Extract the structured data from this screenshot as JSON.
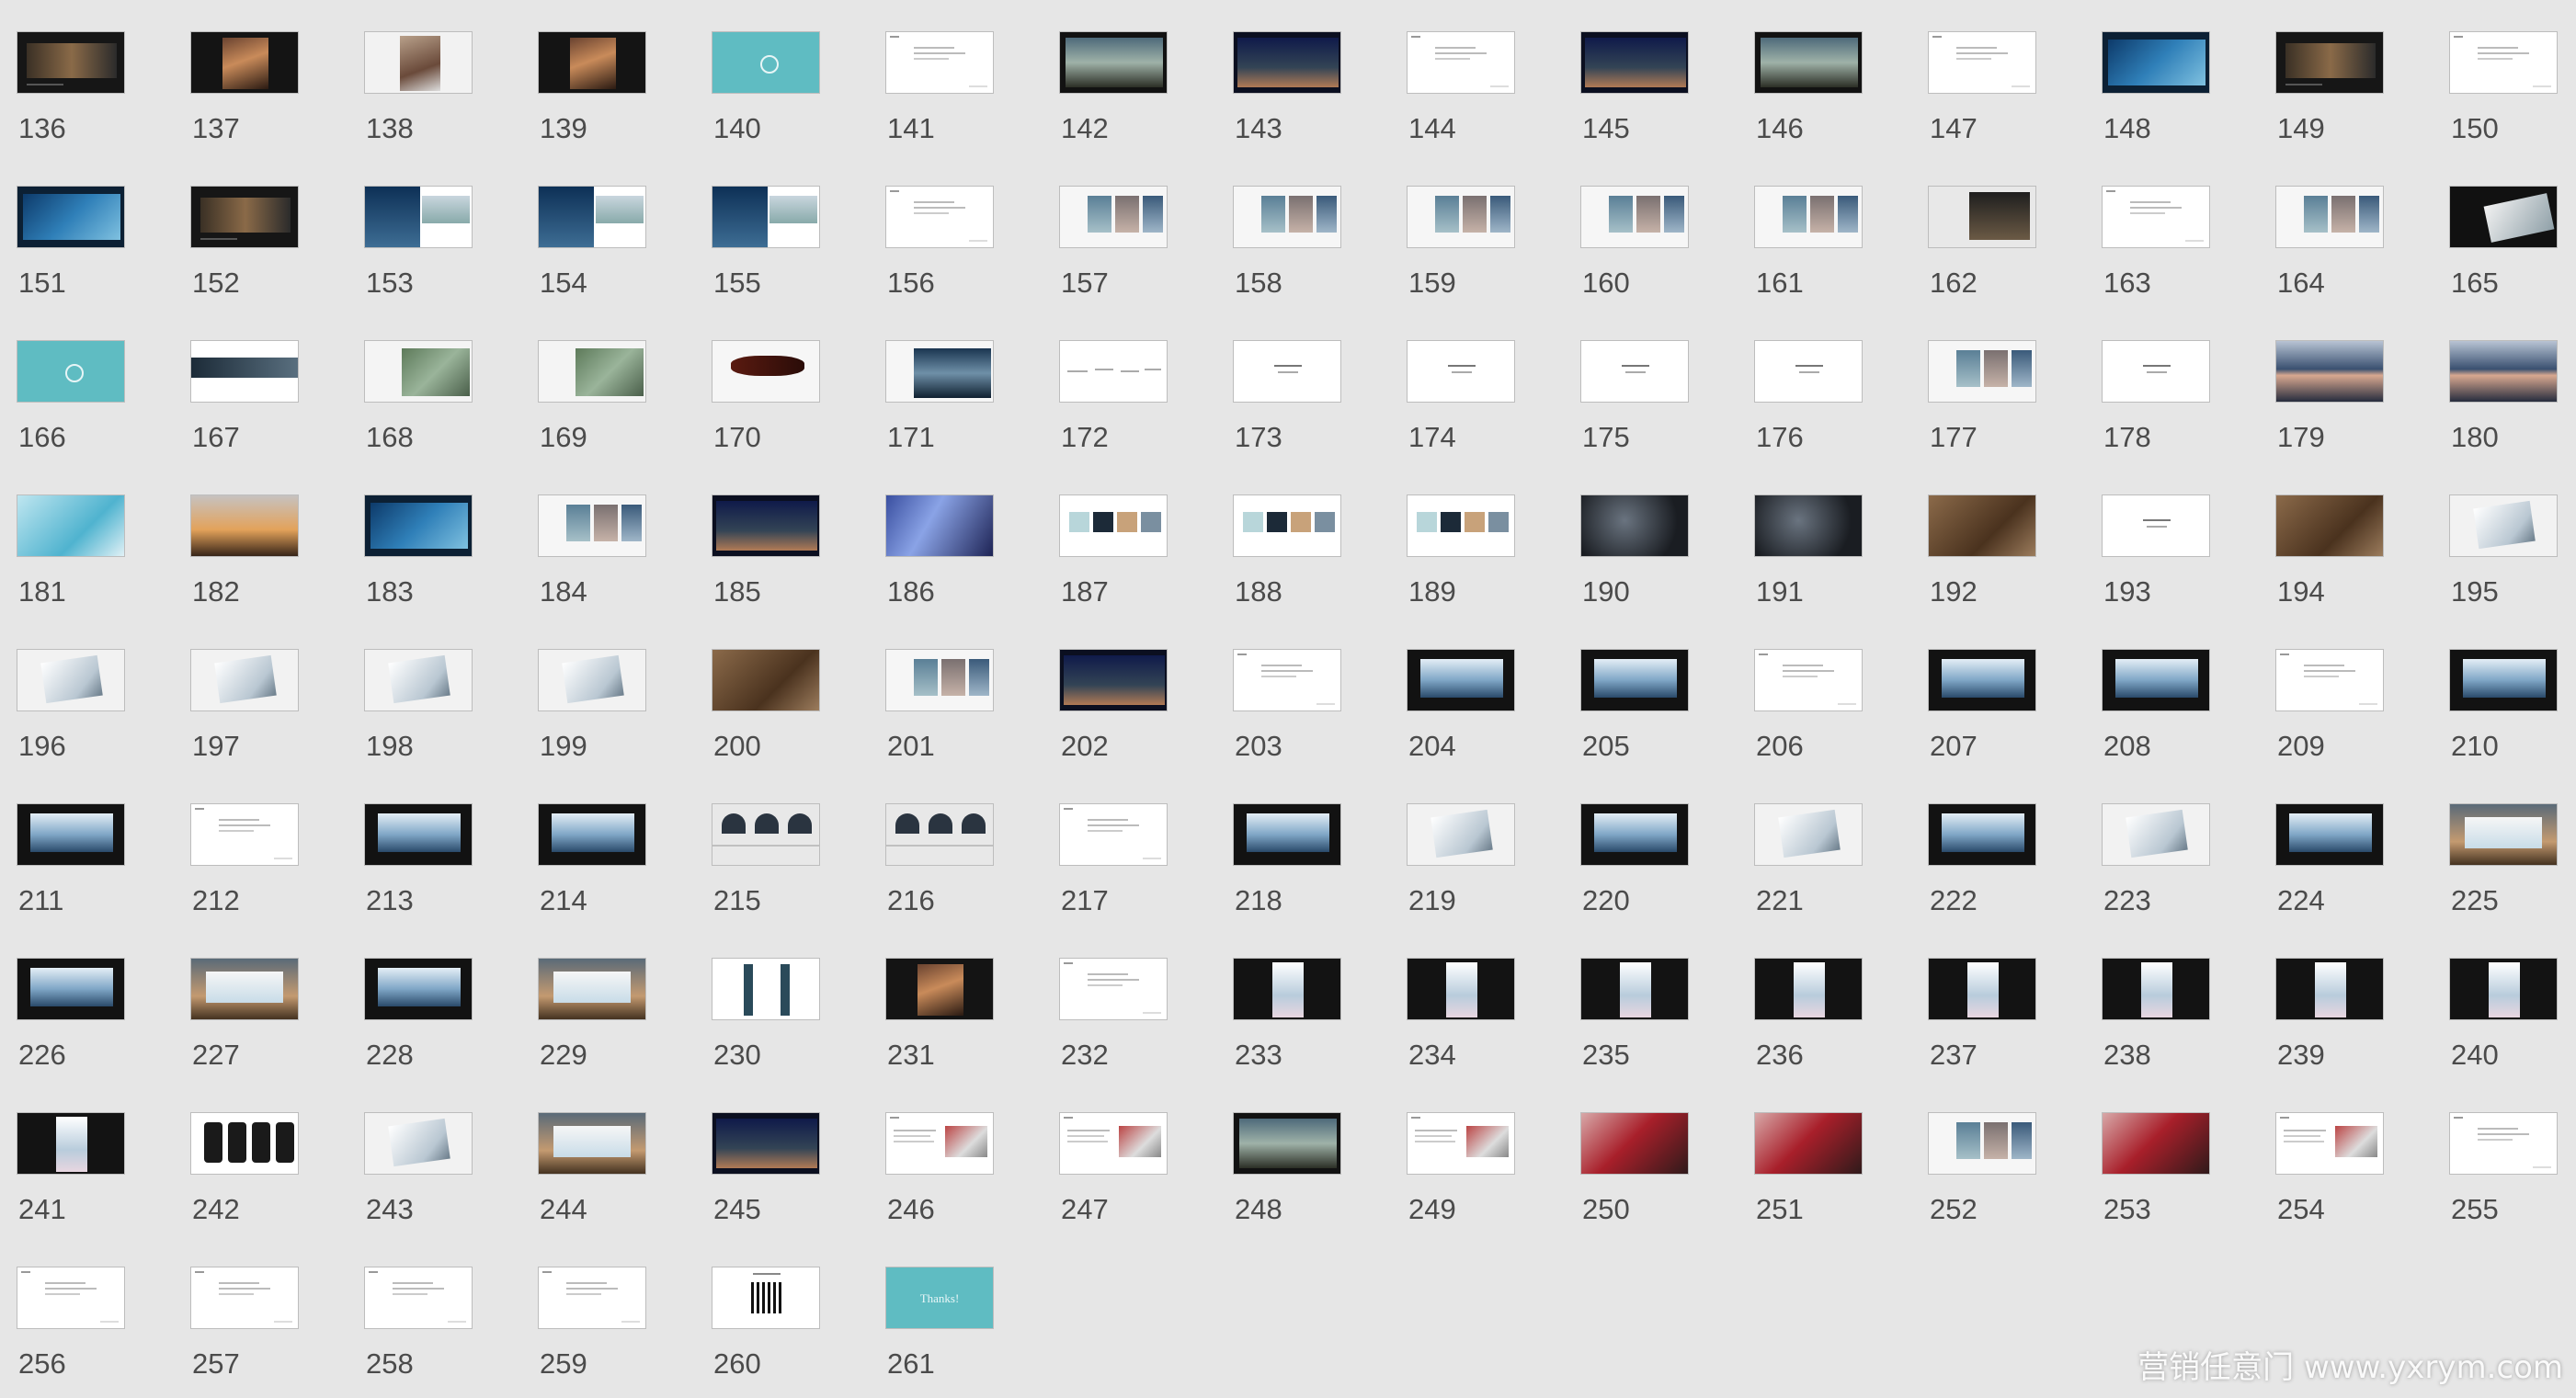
{
  "palette": {
    "background": "#e6e6e6",
    "teal": "#5fbcc2",
    "dark": "#141414",
    "navy": "#0c2034",
    "white": "#ffffff",
    "number_text": "#4b4b4b"
  },
  "slides": [
    {
      "num": "136",
      "style": "dark-gallery"
    },
    {
      "num": "137",
      "style": "dark-portrait"
    },
    {
      "num": "138",
      "style": "light-portrait"
    },
    {
      "num": "139",
      "style": "dark-portrait"
    },
    {
      "num": "140",
      "style": "teal-logo"
    },
    {
      "num": "141",
      "style": "text-white"
    },
    {
      "num": "142",
      "style": "dark-photo"
    },
    {
      "num": "143",
      "style": "night-photo"
    },
    {
      "num": "144",
      "style": "text-white"
    },
    {
      "num": "145",
      "style": "night-photo"
    },
    {
      "num": "146",
      "style": "dark-photo"
    },
    {
      "num": "147",
      "style": "text-white"
    },
    {
      "num": "148",
      "style": "blue-photo"
    },
    {
      "num": "149",
      "style": "dark-gallery"
    },
    {
      "num": "150",
      "style": "text-white"
    },
    {
      "num": "151",
      "style": "blue-photo"
    },
    {
      "num": "152",
      "style": "dark-gallery"
    },
    {
      "num": "153",
      "style": "split-photo"
    },
    {
      "num": "154",
      "style": "split-photo"
    },
    {
      "num": "155",
      "style": "split-photo"
    },
    {
      "num": "156",
      "style": "text-white"
    },
    {
      "num": "157",
      "style": "light-photos"
    },
    {
      "num": "158",
      "style": "light-photos"
    },
    {
      "num": "159",
      "style": "light-photos"
    },
    {
      "num": "160",
      "style": "light-photos"
    },
    {
      "num": "161",
      "style": "light-photos"
    },
    {
      "num": "162",
      "style": "light-dark"
    },
    {
      "num": "163",
      "style": "text-white"
    },
    {
      "num": "164",
      "style": "light-photos"
    },
    {
      "num": "165",
      "style": "dark-card"
    },
    {
      "num": "166",
      "style": "teal-logo"
    },
    {
      "num": "167",
      "style": "light-band"
    },
    {
      "num": "168",
      "style": "light-map"
    },
    {
      "num": "169",
      "style": "light-map"
    },
    {
      "num": "170",
      "style": "light-ink"
    },
    {
      "num": "171",
      "style": "light-sea"
    },
    {
      "num": "172",
      "style": "sketch-white"
    },
    {
      "num": "173",
      "style": "logo-white"
    },
    {
      "num": "174",
      "style": "logo-white"
    },
    {
      "num": "175",
      "style": "logo-white"
    },
    {
      "num": "176",
      "style": "logo-white"
    },
    {
      "num": "177",
      "style": "light-photos"
    },
    {
      "num": "178",
      "style": "logo-white"
    },
    {
      "num": "179",
      "style": "blur-sea"
    },
    {
      "num": "180",
      "style": "blur-sea"
    },
    {
      "num": "181",
      "style": "aqua-photo"
    },
    {
      "num": "182",
      "style": "sunset-photo"
    },
    {
      "num": "183",
      "style": "blue-photo"
    },
    {
      "num": "184",
      "style": "light-photos"
    },
    {
      "num": "185",
      "style": "night-photo"
    },
    {
      "num": "186",
      "style": "pool-photo"
    },
    {
      "num": "187",
      "style": "swatch"
    },
    {
      "num": "188",
      "style": "swatch"
    },
    {
      "num": "189",
      "style": "swatch"
    },
    {
      "num": "190",
      "style": "dark-texture"
    },
    {
      "num": "191",
      "style": "dark-texture"
    },
    {
      "num": "192",
      "style": "brown-texture"
    },
    {
      "num": "193",
      "style": "logo-white"
    },
    {
      "num": "194",
      "style": "brown-texture"
    },
    {
      "num": "195",
      "style": "light-card"
    },
    {
      "num": "196",
      "style": "light-card"
    },
    {
      "num": "197",
      "style": "light-card"
    },
    {
      "num": "198",
      "style": "light-card"
    },
    {
      "num": "199",
      "style": "light-card"
    },
    {
      "num": "200",
      "style": "brown-texture"
    },
    {
      "num": "201",
      "style": "light-photos"
    },
    {
      "num": "202",
      "style": "night-photo"
    },
    {
      "num": "203",
      "style": "text-white"
    },
    {
      "num": "204",
      "style": "dark-billboard"
    },
    {
      "num": "205",
      "style": "dark-billboard"
    },
    {
      "num": "206",
      "style": "text-white"
    },
    {
      "num": "207",
      "style": "dark-billboard"
    },
    {
      "num": "208",
      "style": "dark-billboard"
    },
    {
      "num": "209",
      "style": "text-white"
    },
    {
      "num": "210",
      "style": "dark-billboard"
    },
    {
      "num": "211",
      "style": "dark-billboard"
    },
    {
      "num": "212",
      "style": "text-white"
    },
    {
      "num": "213",
      "style": "dark-billboard"
    },
    {
      "num": "214",
      "style": "dark-billboard"
    },
    {
      "num": "215",
      "style": "light-arch"
    },
    {
      "num": "216",
      "style": "light-arch"
    },
    {
      "num": "217",
      "style": "text-white"
    },
    {
      "num": "218",
      "style": "dark-billboard"
    },
    {
      "num": "219",
      "style": "light-card"
    },
    {
      "num": "220",
      "style": "dark-billboard"
    },
    {
      "num": "221",
      "style": "light-card"
    },
    {
      "num": "222",
      "style": "dark-billboard"
    },
    {
      "num": "223",
      "style": "light-card"
    },
    {
      "num": "224",
      "style": "dark-billboard"
    },
    {
      "num": "225",
      "style": "sky-billboard"
    },
    {
      "num": "226",
      "style": "dark-billboard"
    },
    {
      "num": "227",
      "style": "sky-billboard"
    },
    {
      "num": "228",
      "style": "dark-billboard"
    },
    {
      "num": "229",
      "style": "sky-billboard"
    },
    {
      "num": "230",
      "style": "light-poles"
    },
    {
      "num": "231",
      "style": "dark-portrait"
    },
    {
      "num": "232",
      "style": "text-white"
    },
    {
      "num": "233",
      "style": "dark-panel"
    },
    {
      "num": "234",
      "style": "dark-panel"
    },
    {
      "num": "235",
      "style": "dark-panel"
    },
    {
      "num": "236",
      "style": "dark-panel"
    },
    {
      "num": "237",
      "style": "dark-panel"
    },
    {
      "num": "238",
      "style": "dark-panel"
    },
    {
      "num": "239",
      "style": "dark-panel"
    },
    {
      "num": "240",
      "style": "dark-panel"
    },
    {
      "num": "241",
      "style": "dark-panel"
    },
    {
      "num": "242",
      "style": "phones"
    },
    {
      "num": "243",
      "style": "light-card"
    },
    {
      "num": "244",
      "style": "sky-billboard"
    },
    {
      "num": "245",
      "style": "night-photo"
    },
    {
      "num": "246",
      "style": "text-photo"
    },
    {
      "num": "247",
      "style": "text-photo"
    },
    {
      "num": "248",
      "style": "dark-photo"
    },
    {
      "num": "249",
      "style": "text-photo"
    },
    {
      "num": "250",
      "style": "red-photo"
    },
    {
      "num": "251",
      "style": "red-photo"
    },
    {
      "num": "252",
      "style": "light-photos"
    },
    {
      "num": "253",
      "style": "red-photo"
    },
    {
      "num": "254",
      "style": "text-photo"
    },
    {
      "num": "255",
      "style": "text-white"
    },
    {
      "num": "256",
      "style": "text-white"
    },
    {
      "num": "257",
      "style": "text-white"
    },
    {
      "num": "258",
      "style": "text-white"
    },
    {
      "num": "259",
      "style": "text-white"
    },
    {
      "num": "260",
      "style": "qr"
    },
    {
      "num": "261",
      "style": "teal-thanks"
    }
  ],
  "thanks_text": "Thanks!",
  "watermark": "营销任意门 www.yxrym.com"
}
